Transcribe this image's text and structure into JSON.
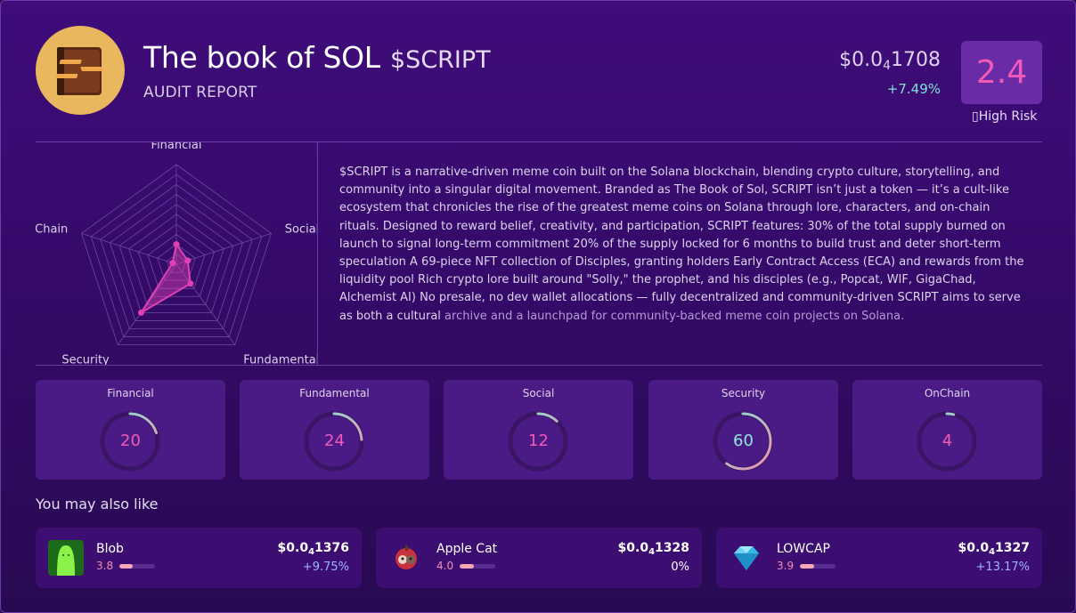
{
  "header": {
    "title": "The book of SOL",
    "ticker": "$SCRIPT",
    "subtitle": "AUDIT REPORT",
    "price_prefix": "$0.0",
    "price_zeros": "4",
    "price_digits": "1708",
    "change": "+7.49%",
    "score": "2.4",
    "risk_label": "High Risk"
  },
  "radar": {
    "axes": [
      "Financial",
      "Social",
      "Fundamental",
      "Security",
      "OnChain"
    ],
    "values": [
      20,
      12,
      24,
      60,
      4
    ],
    "max": 100
  },
  "description": {
    "main": "$SCRIPT is a narrative-driven meme coin built on the Solana blockchain, blending crypto culture, storytelling, and community into a singular digital movement. Branded as The Book of Sol, SCRIPT isn’t just a token — it’s a cult-like ecosystem that chronicles the rise of the greatest meme coins on Solana through lore, characters, and on-chain rituals. Designed to reward belief, creativity, and participation, SCRIPT features: 30% of the total supply burned on launch to signal long-term commitment 20% of the supply locked for 6 months to build trust and deter short-term speculation A 69-piece NFT collection of Disciples, granting holders Early Contract Access (ECA) and rewards from the liquidity pool Rich crypto lore built around \"Solly,\" the prophet, and his disciples (e.g., Popcat, WIF, GigaChad, Alchemist AI) No presale, no dev wallet allocations — fully decentralized and community-driven SCRIPT aims to serve as both a cultural",
    "faded": "archive and a launchpad for community-backed meme coin projects on Solana."
  },
  "scores": [
    {
      "label": "Financial",
      "value": "20",
      "pct": 20
    },
    {
      "label": "Fundamental",
      "value": "24",
      "pct": 24
    },
    {
      "label": "Social",
      "value": "12",
      "pct": 12
    },
    {
      "label": "Security",
      "value": "60",
      "pct": 60
    },
    {
      "label": "OnChain",
      "value": "4",
      "pct": 4
    }
  ],
  "colors": {
    "ring_track": "#3a1566",
    "ring_low": "#f28fb0",
    "ring_high": "#7fe3d4",
    "num_pink": "#f25ab9",
    "num_teal": "#8fe6e0",
    "radar_fill": "#e040b4",
    "change_up": "#7fe3d4"
  },
  "related": {
    "heading": "You may also like",
    "items": [
      {
        "name": "Blob",
        "score": "3.8",
        "pct": 38,
        "price_prefix": "$0.0",
        "price_zeros": "4",
        "price_digits": "1376",
        "change": "+9.75%",
        "change_color": "#9fb4ff",
        "icon": "blob-icon"
      },
      {
        "name": "Apple Cat",
        "score": "4.0",
        "pct": 40,
        "price_prefix": "$0.0",
        "price_zeros": "4",
        "price_digits": "1328",
        "change": "0%",
        "change_color": "#ffffff",
        "icon": "apple-cat-icon"
      },
      {
        "name": "LOWCAP",
        "score": "3.9",
        "pct": 39,
        "price_prefix": "$0.0",
        "price_zeros": "4",
        "price_digits": "1327",
        "change": "+13.17%",
        "change_color": "#9fb4ff",
        "icon": "diamond-icon"
      }
    ]
  }
}
